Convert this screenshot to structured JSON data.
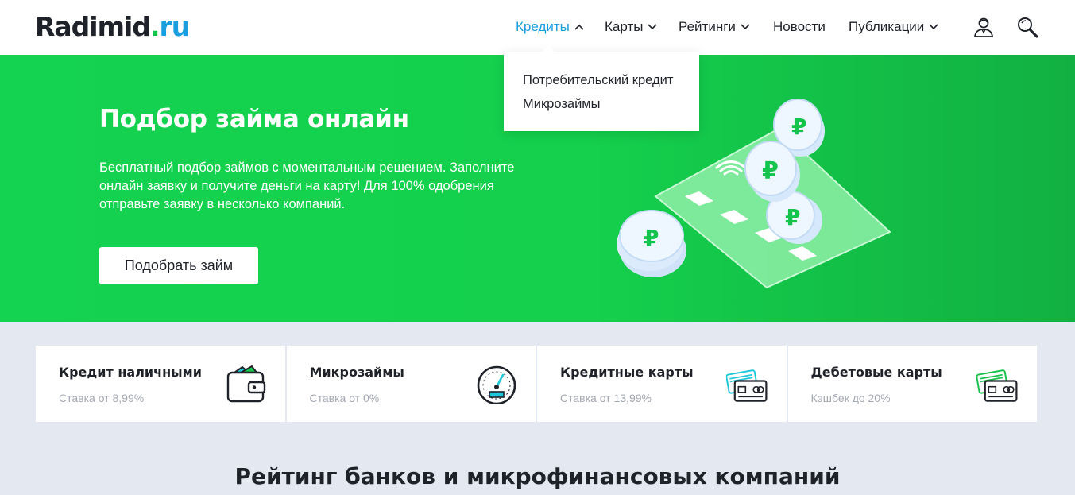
{
  "header": {
    "logo": {
      "name": "Radimid",
      "dot": ".",
      "tld": "ru"
    },
    "nav": [
      {
        "label": "Кредиты",
        "active": true,
        "has_dropdown": true,
        "expanded": true
      },
      {
        "label": "Карты",
        "has_dropdown": true
      },
      {
        "label": "Рейтинги",
        "has_dropdown": true
      },
      {
        "label": "Новости",
        "has_dropdown": false
      },
      {
        "label": "Публикации",
        "has_dropdown": true
      }
    ],
    "icons": [
      "user-icon",
      "search-icon"
    ]
  },
  "dropdown": {
    "items": [
      "Потребительский кредит",
      "Микрозаймы"
    ]
  },
  "hero": {
    "title": "Подбор займа онлайн",
    "text": "Бесплатный подбор займов с моментальным решением. Заполните онлайн заявку и получите деньги на карту! Для 100% одобрения отправьте заявку в несколько компаний.",
    "button": "Подобрать займ"
  },
  "cards": [
    {
      "title": "Кредит наличными",
      "subtitle": "Ставка от 8,99%",
      "icon": "wallet-icon"
    },
    {
      "title": "Микрозаймы",
      "subtitle": "Ставка от 0%",
      "icon": "speedometer-icon"
    },
    {
      "title": "Кредитные карты",
      "subtitle": "Ставка от 13,99%",
      "icon": "credit-cards-icon"
    },
    {
      "title": "Дебетовые карты",
      "subtitle": "Кэшбек до 20%",
      "icon": "debit-cards-icon"
    }
  ],
  "section": {
    "title": "Рейтинг банков и микрофинансовых компаний"
  },
  "colors": {
    "brand_green": "#14d350",
    "accent_blue": "#1a9ee0",
    "text": "#1f2229",
    "muted": "#a4a8b3",
    "page_bg": "#e4e8f1"
  }
}
